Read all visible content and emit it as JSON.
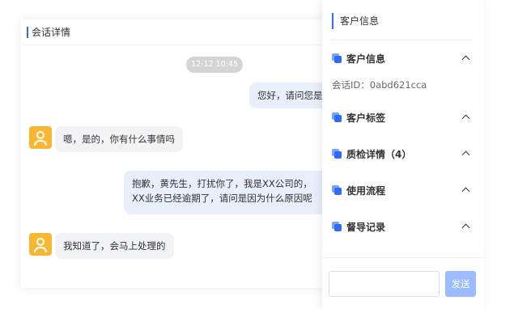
{
  "conversation": {
    "title": "会话详情",
    "timestamp": "12-12 10:45",
    "messages": [
      {
        "side": "me",
        "text": "您好，请问您是"
      },
      {
        "side": "other",
        "text": "嗯，是的，你有什么事情吗"
      },
      {
        "side": "me",
        "line1": "抱歉，黄先生，打扰你了，我是XX公司的，",
        "line2": "XX业务已经逾期了，请问是因为什么原因呢"
      },
      {
        "side": "other",
        "text": "我知道了，会马上处理的"
      }
    ]
  },
  "panel": {
    "title": "客户信息",
    "sections": [
      {
        "label": "客户信息",
        "icon": "section-icon",
        "expanded": true
      },
      {
        "label": "客户标签",
        "icon": "section-icon",
        "expanded": true
      },
      {
        "label": "质检详情（4）",
        "icon": "section-icon",
        "expanded": true
      },
      {
        "label": "使用流程",
        "icon": "section-icon",
        "expanded": true
      },
      {
        "label": "督导记录",
        "icon": "section-icon",
        "expanded": true
      }
    ],
    "session_id": "会话ID：0abd621cca",
    "send_label": "发送",
    "input_value": ""
  },
  "colors": {
    "accent": "#2f6bff",
    "send_button": "#9cbcff",
    "avatar": "#f7b733",
    "bubble_me": "#e9eefb",
    "bubble_other": "#f2f3f5"
  }
}
